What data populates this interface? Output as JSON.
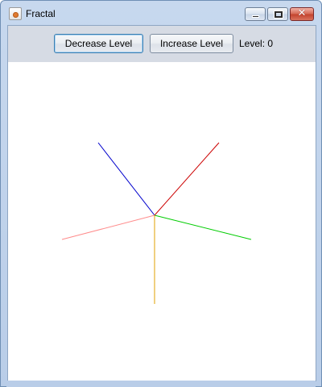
{
  "window": {
    "title": "Fractal",
    "icon": "java-icon",
    "controls": {
      "minimize": {
        "icon": "minimize-icon"
      },
      "maximize": {
        "icon": "maximize-icon"
      },
      "close": {
        "icon": "close-icon",
        "glyph": "✕"
      }
    }
  },
  "toolbar": {
    "decrease_label": "Decrease Level",
    "increase_label": "Increase Level",
    "level_label": "Level: 0"
  },
  "fractal": {
    "branches": [
      {
        "name": "branch-upper-left",
        "color": "#0000cc"
      },
      {
        "name": "branch-upper-right",
        "color": "#cc0000"
      },
      {
        "name": "branch-right",
        "color": "#00cc00"
      },
      {
        "name": "branch-down",
        "color": "#e0a000"
      },
      {
        "name": "branch-left",
        "color": "#ff8c8c"
      }
    ]
  }
}
